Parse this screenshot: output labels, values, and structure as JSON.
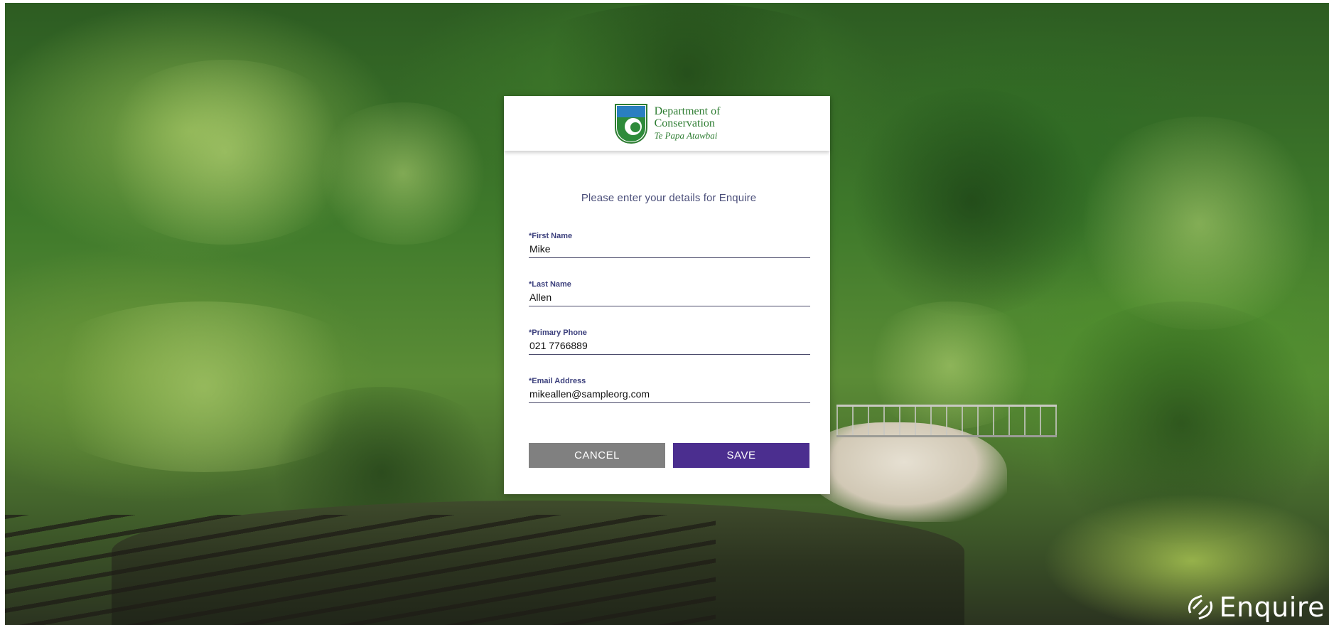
{
  "header": {
    "logo_line1": "Department of",
    "logo_line2": "Conservation",
    "logo_line3": "Te Papa Atawbai"
  },
  "form": {
    "prompt": "Please enter your details for Enquire",
    "fields": [
      {
        "label": "*First Name",
        "value": "Mike"
      },
      {
        "label": "*Last Name",
        "value": "Allen"
      },
      {
        "label": "*Primary Phone",
        "value": "021 7766889"
      },
      {
        "label": "*Email Address",
        "value": "mikeallen@sampleorg.com"
      }
    ],
    "cancel_label": "CANCEL",
    "save_label": "SAVE"
  },
  "brand": {
    "name": "Enquire"
  },
  "colors": {
    "save_button": "#4b2e8f",
    "cancel_button": "#808080",
    "label_text": "#3b3f7c",
    "logo_green": "#2e7d32"
  }
}
